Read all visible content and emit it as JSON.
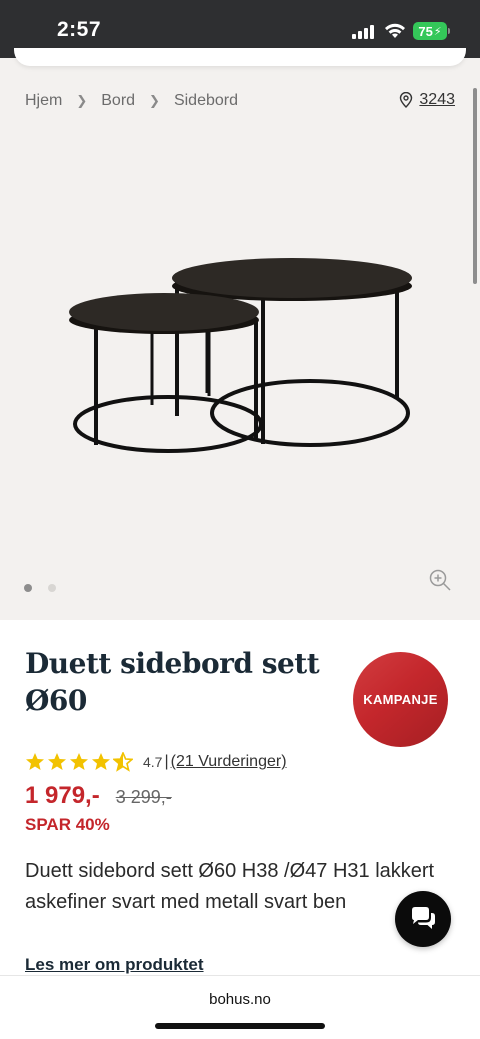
{
  "status_bar": {
    "time": "2:57",
    "battery": "75"
  },
  "breadcrumb": {
    "items": [
      "Hjem",
      "Bord",
      "Sidebord"
    ]
  },
  "store": {
    "number": "3243",
    "icon": "location-pin-icon"
  },
  "gallery": {
    "total_images": 2,
    "active_index": 0
  },
  "product": {
    "title_line1": "Duett sidebord sett",
    "title_line2": "Ø60",
    "badge": "KAMPANJE",
    "rating": 4.7,
    "rating_text": "4.7",
    "reviews": "(21 Vurderinger)",
    "price": "1 979,-",
    "old_price": "3 299,-",
    "savings": "SPAR 40%",
    "description": "Duett sidebord sett Ø60 H38 /Ø47 H31 lakkert askefiner svart med metall svart ben",
    "read_more": "Les mer om produktet"
  },
  "browser": {
    "url": "bohus.no"
  },
  "colors": {
    "accent": "#c4262b",
    "star": "#f2c200",
    "hero_bg": "#f3f1ef",
    "status_bar": "#2e2f31"
  }
}
